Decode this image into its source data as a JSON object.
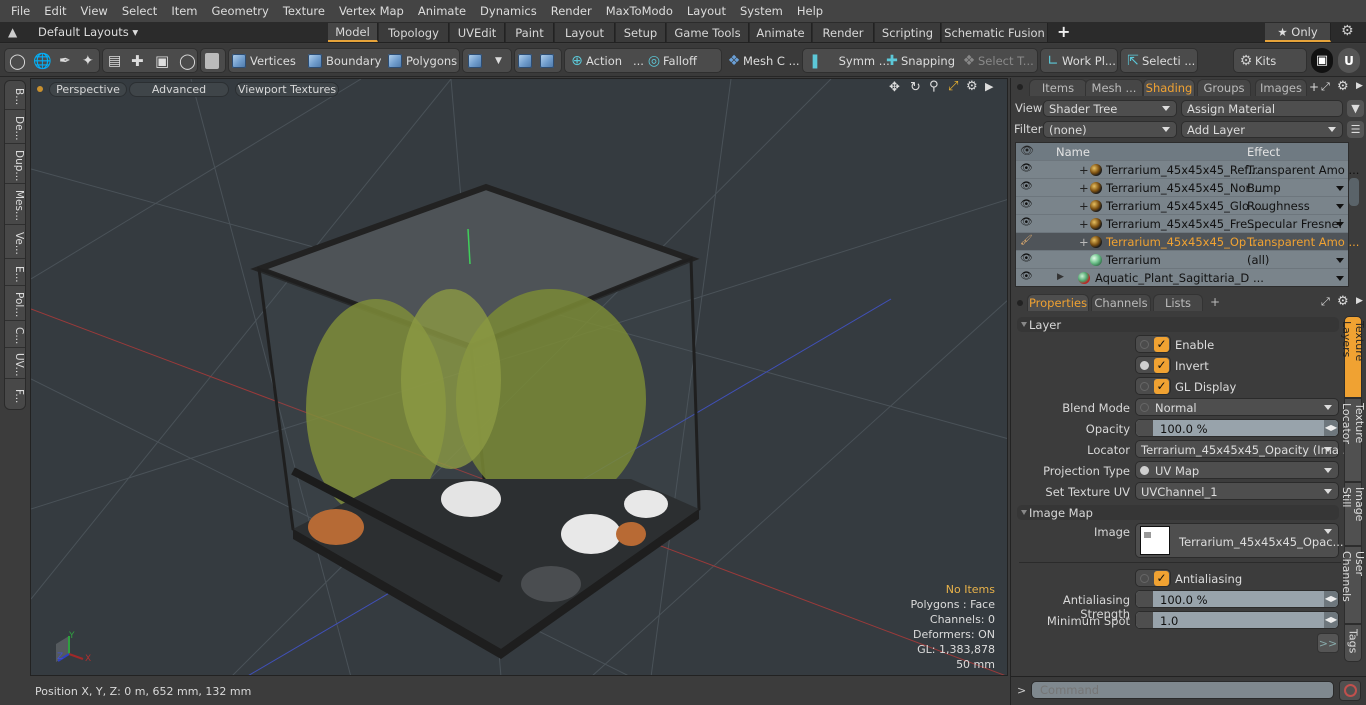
{
  "menu": [
    "File",
    "Edit",
    "View",
    "Select",
    "Item",
    "Geometry",
    "Texture",
    "Vertex Map",
    "Animate",
    "Dynamics",
    "Render",
    "MaxToModo",
    "Layout",
    "System",
    "Help"
  ],
  "layouts": {
    "dropdown": "Default Layouts ▾",
    "tabs": [
      "Model",
      "Topology",
      "UVEdit",
      "Paint",
      "Layout",
      "Setup",
      "Game Tools",
      "Animate",
      "Render",
      "Scripting",
      "Schematic Fusion"
    ],
    "active_tab": "Model",
    "add": "+",
    "only": "★ Only",
    "accent_color": "#e6a33a"
  },
  "toolbar": {
    "vertices": "Vertices",
    "boundary": "Boundary",
    "polygons": "Polygons",
    "action": "Action",
    "action_more": "...",
    "falloff": "Falloff",
    "mesh_c": "Mesh C ...",
    "symm": "Symm ...",
    "snapping": "Snapping",
    "select_t": "Select T...",
    "work_pl": "Work Pl...",
    "selecti": "Selecti ...",
    "kits": "Kits"
  },
  "left_tabs": [
    "B...",
    "De...",
    "Dup...",
    "Mes...",
    "Ve...",
    "E...",
    "Pol...",
    "C...",
    "UV...",
    "F..."
  ],
  "viewport": {
    "buttons": [
      "Perspective",
      "Advanced",
      "Viewport Textures"
    ],
    "hud": {
      "selection": "No Items",
      "polygons": "Polygons : Face",
      "channels": "Channels: 0",
      "deformers": "Deformers: ON",
      "gl": "GL: 1,383,878",
      "scale": "50 mm"
    },
    "axes": {
      "x": "X",
      "y": "Y",
      "z": "Z"
    }
  },
  "status": {
    "position": "Position X, Y, Z:   0 m, 652 mm, 132 mm"
  },
  "shading_panel": {
    "tabs": [
      "Items",
      "Mesh ...",
      "Shading",
      "Groups",
      "Images"
    ],
    "active_tab": "Shading",
    "view_label": "View",
    "view_value": "Shader Tree",
    "assign_material": "Assign Material",
    "filter_label": "Filter",
    "filter_value": "(none)",
    "add_layer": "Add Layer",
    "columns": {
      "name": "Name",
      "effect": "Effect"
    },
    "rows": [
      {
        "name": "Terrarium_45x45x45_Ref...",
        "effect": "Transparent Amo ...",
        "type": "texture",
        "selected": false
      },
      {
        "name": "Terrarium_45x45x45_Nor ...",
        "effect": "Bump",
        "type": "texture",
        "selected": false
      },
      {
        "name": "Terrarium_45x45x45_Glo ...",
        "effect": "Roughness",
        "type": "texture",
        "selected": false
      },
      {
        "name": "Terrarium_45x45x45_Fre ...",
        "effect": "Specular Fresnel",
        "type": "texture",
        "selected": false
      },
      {
        "name": "Terrarium_45x45x45_Op ...",
        "effect": "Transparent Amo ...",
        "type": "texture",
        "selected": true
      },
      {
        "name": "Terrarium",
        "effect": "(all)",
        "type": "material",
        "selected": false
      },
      {
        "name": "Aquatic_Plant_Sagittaria_D ...",
        "effect": "",
        "type": "mask",
        "selected": false
      }
    ]
  },
  "properties_panel": {
    "tabs": [
      "Properties",
      "Channels",
      "Lists"
    ],
    "active_tab": "Properties",
    "add": "+",
    "layer_section": "Layer",
    "enable": {
      "label": "Enable",
      "checked": true
    },
    "invert": {
      "label": "Invert",
      "checked": true
    },
    "gl_display": {
      "label": "GL Display",
      "checked": true
    },
    "blend_mode": {
      "label": "Blend Mode",
      "value": "Normal"
    },
    "opacity": {
      "label": "Opacity",
      "value": "100.0 %"
    },
    "locator": {
      "label": "Locator",
      "value": "Terrarium_45x45x45_Opacity (Ima ..."
    },
    "projection_type": {
      "label": "Projection Type",
      "value": "UV Map"
    },
    "set_texture_uv": {
      "label": "Set Texture UV",
      "value": "UVChannel_1"
    },
    "image_map_section": "Image Map",
    "image": {
      "label": "Image",
      "value": "Terrarium_45x45x45_Opac..."
    },
    "antialiasing": {
      "label": "Antialiasing",
      "checked": true
    },
    "antialiasing_strength": {
      "label": "Antialiasing Strength",
      "value": "100.0 %"
    },
    "minimum_spot": {
      "label": "Minimum Spot",
      "value": "1.0"
    },
    "more": ">>",
    "side_tabs": [
      "Texture Layers",
      "Texture Locator",
      "Image Still",
      "User Channels",
      "Tags"
    ],
    "active_side_tab": "Texture Layers"
  },
  "command": {
    "prompt": ">",
    "placeholder": "Command"
  }
}
